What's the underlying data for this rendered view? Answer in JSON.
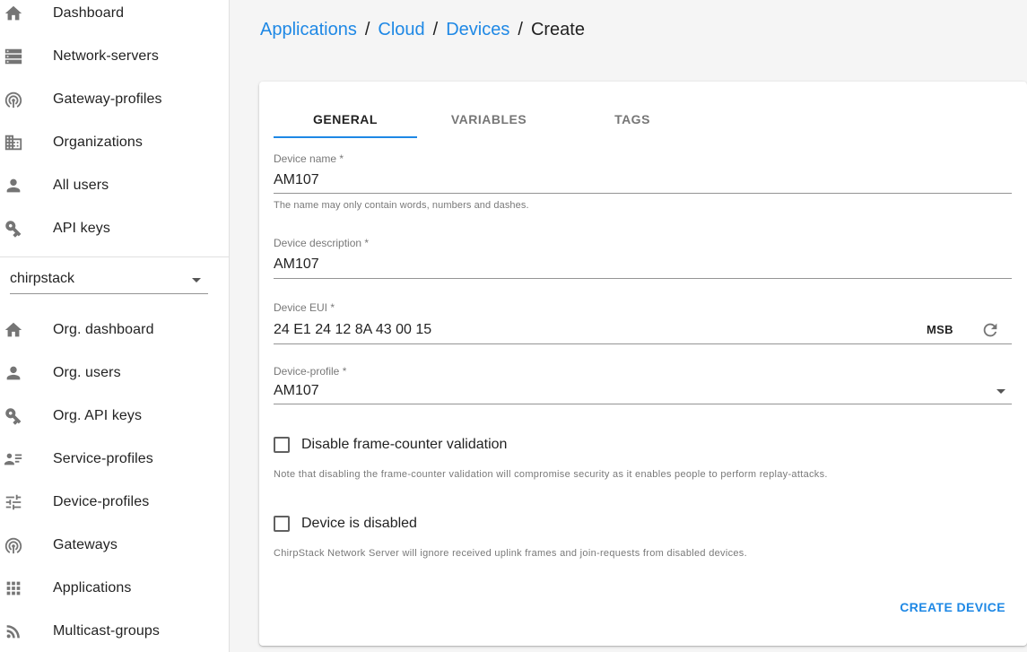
{
  "sidebar": {
    "top_items": [
      {
        "label": "Dashboard",
        "icon": "home-icon"
      },
      {
        "label": "Network-servers",
        "icon": "server-icon"
      },
      {
        "label": "Gateway-profiles",
        "icon": "wifi-tethering-icon"
      },
      {
        "label": "Organizations",
        "icon": "domain-icon"
      },
      {
        "label": "All users",
        "icon": "person-icon"
      },
      {
        "label": "API keys",
        "icon": "vpn-key-icon"
      }
    ],
    "org_select": {
      "value": "chirpstack"
    },
    "org_items": [
      {
        "label": "Org. dashboard",
        "icon": "home-icon"
      },
      {
        "label": "Org. users",
        "icon": "person-icon"
      },
      {
        "label": "Org. API keys",
        "icon": "vpn-key-icon"
      },
      {
        "label": "Service-profiles",
        "icon": "account-details-icon"
      },
      {
        "label": "Device-profiles",
        "icon": "tune-icon"
      },
      {
        "label": "Gateways",
        "icon": "wifi-tethering-icon"
      },
      {
        "label": "Applications",
        "icon": "apps-icon"
      },
      {
        "label": "Multicast-groups",
        "icon": "rss-feed-icon"
      }
    ]
  },
  "breadcrumb": {
    "items": [
      "Applications",
      "Cloud",
      "Devices"
    ],
    "separator": "/",
    "current": "Create"
  },
  "tabs": [
    {
      "label": "GENERAL",
      "active": true
    },
    {
      "label": "VARIABLES",
      "active": false
    },
    {
      "label": "TAGS",
      "active": false
    }
  ],
  "form": {
    "device_name": {
      "label": "Device name *",
      "value": "AM107",
      "helper": "The name may only contain words, numbers and dashes."
    },
    "device_description": {
      "label": "Device description *",
      "value": "AM107"
    },
    "device_eui": {
      "label": "Device EUI *",
      "value": "24 E1 24 12 8A 43 00 15",
      "byte_order": "MSB",
      "refresh_icon": "refresh-icon"
    },
    "device_profile": {
      "label": "Device-profile *",
      "value": "AM107"
    },
    "disable_fcnt": {
      "label": "Disable frame-counter validation",
      "checked": false,
      "note": "Note that disabling the frame-counter validation will compromise security as it enables people to perform replay-attacks."
    },
    "device_disabled": {
      "label": "Device is disabled",
      "checked": false,
      "note": "ChirpStack Network Server will ignore received uplink frames and join-requests from disabled devices."
    },
    "submit_label": "CREATE DEVICE"
  },
  "colors": {
    "accent": "#1e88e5",
    "autofill": "#e8f0fe",
    "background": "#f5f5f5"
  }
}
